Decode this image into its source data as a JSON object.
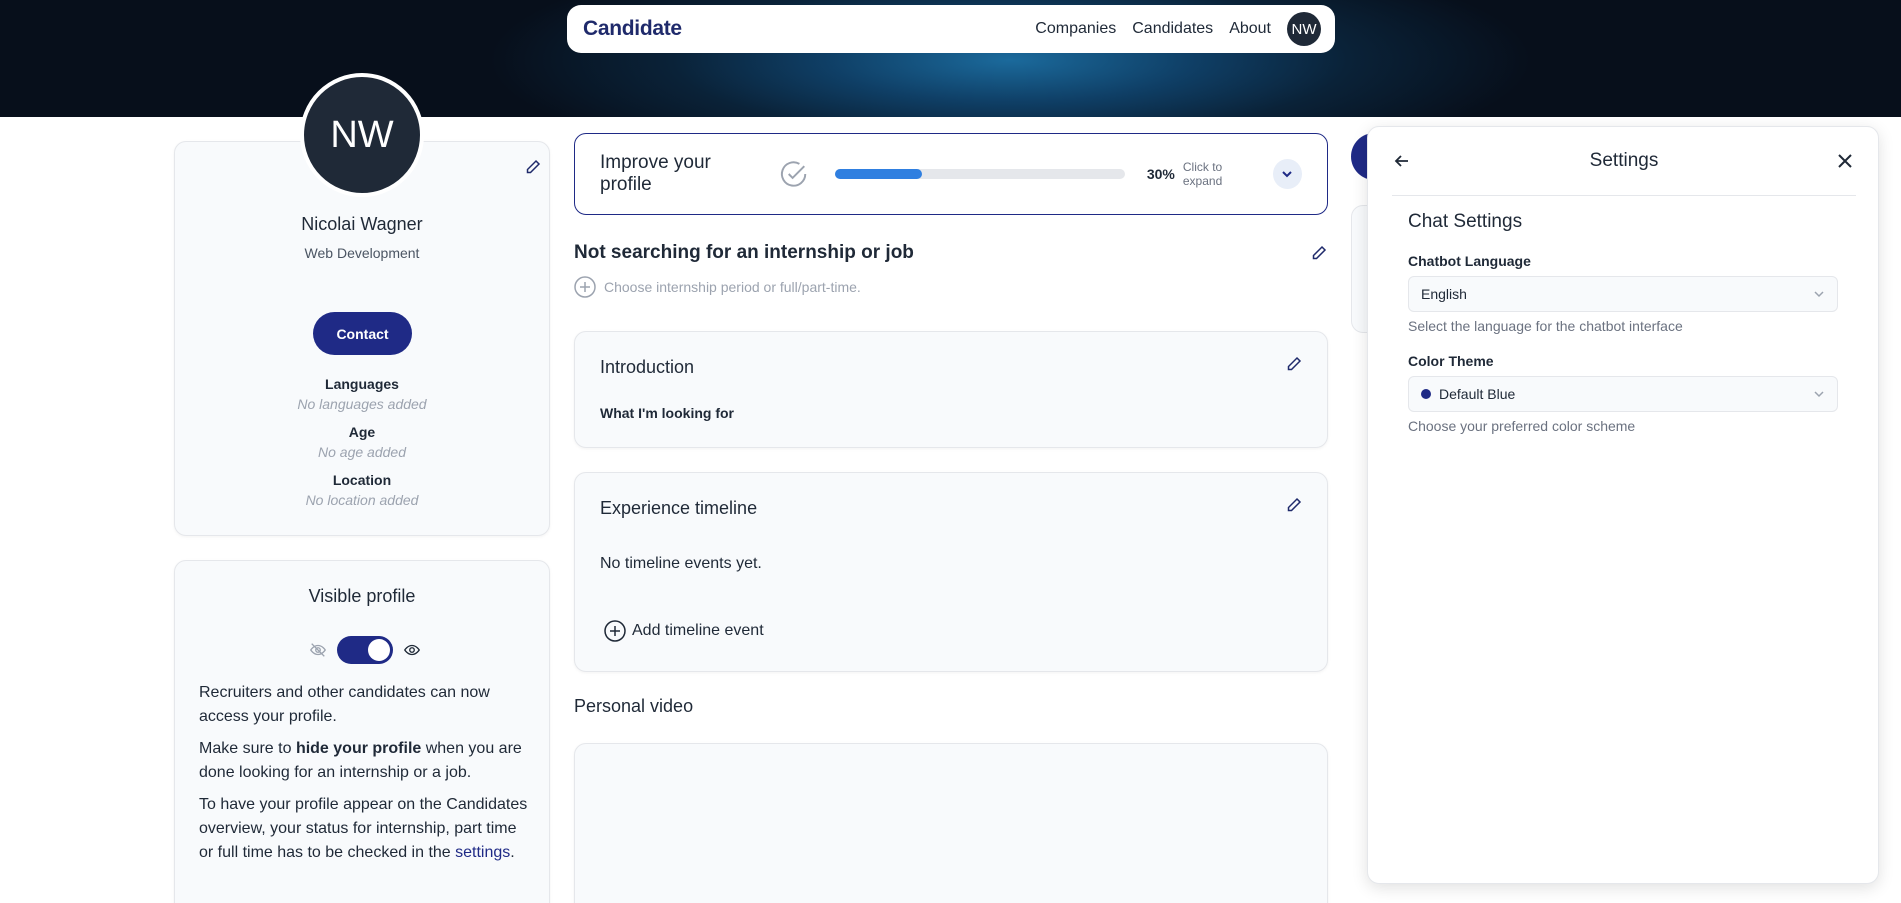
{
  "nav": {
    "logo": "Candidate",
    "links": [
      "Companies",
      "Candidates",
      "About"
    ],
    "avatar_initials": "NW"
  },
  "profile": {
    "initials": "NW",
    "name": "Nicolai Wagner",
    "role": "Web Development",
    "contact_label": "Contact",
    "languages_label": "Languages",
    "languages_value": "No languages added",
    "age_label": "Age",
    "age_value": "No age added",
    "location_label": "Location",
    "location_value": "No location added"
  },
  "visible_profile": {
    "title": "Visible profile",
    "enabled": true,
    "p1": "Recruiters and other candidates can now access your profile.",
    "p2_pre": "Make sure to ",
    "p2_bold": "hide your profile",
    "p2_post": " when you are done looking for an internship or a job.",
    "p3_pre": "To have your profile appear on the Candidates overview, your status for internship, part time or full time has to be checked in the ",
    "p3_link": "settings",
    "p3_post": "."
  },
  "improve": {
    "title": "Improve your profile",
    "progress": 30,
    "percent_label": "30%",
    "hint": "Click to expand"
  },
  "status": {
    "title": "Not searching for an internship or job",
    "hint": "Choose internship period or full/part-time."
  },
  "introduction": {
    "title": "Introduction",
    "subtitle": "What I'm looking for"
  },
  "experience": {
    "title": "Experience timeline",
    "empty": "No timeline events yet.",
    "add_label": "Add timeline event"
  },
  "video": {
    "title": "Personal video"
  },
  "settings": {
    "title": "Settings",
    "section": "Chat Settings",
    "language_label": "Chatbot Language",
    "language_value": "English",
    "language_help": "Select the language for the chatbot interface",
    "theme_label": "Color Theme",
    "theme_value": "Default Blue",
    "theme_color": "#1f2a86",
    "theme_help": "Choose your preferred color scheme"
  },
  "colors": {
    "primary": "#1f2a86",
    "progress": "#2f7fe0"
  }
}
